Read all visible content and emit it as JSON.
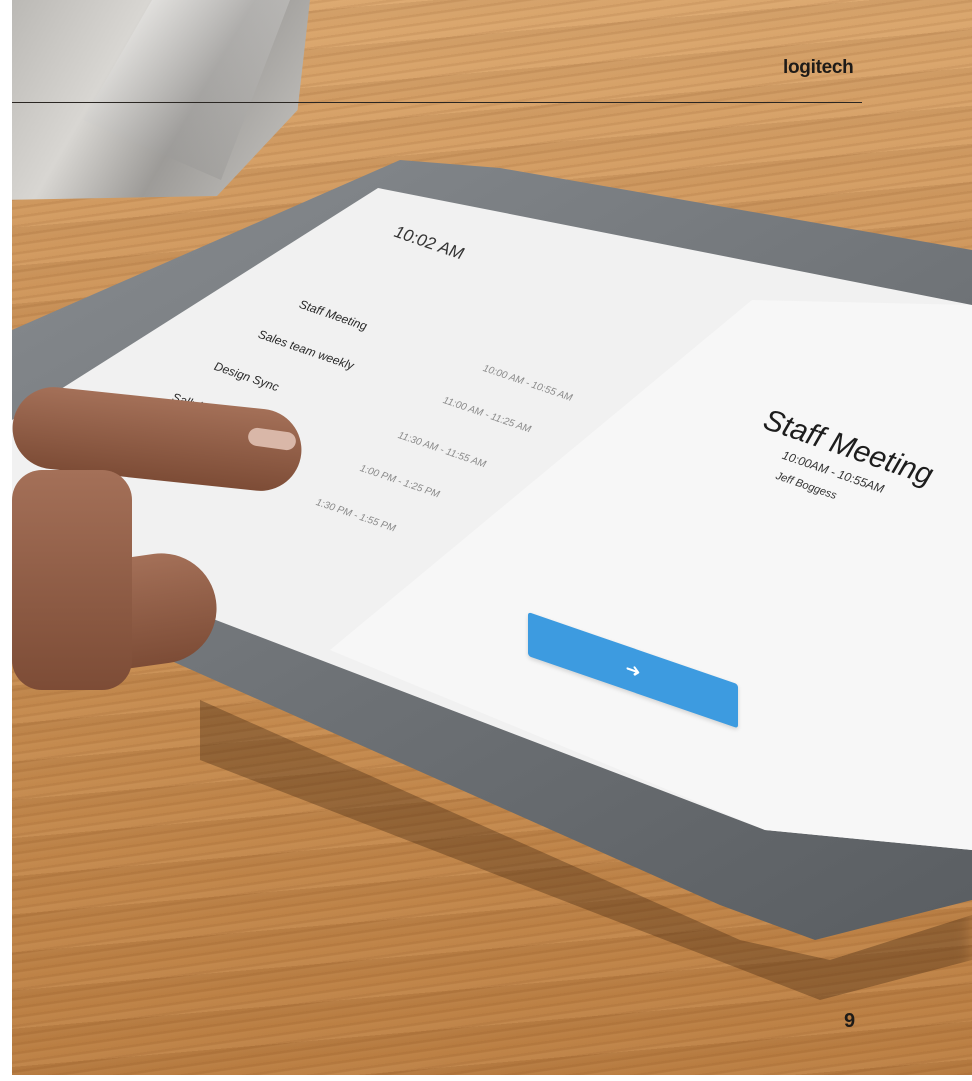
{
  "brand": {
    "logo": "logitech"
  },
  "page": {
    "number": "9"
  },
  "tablet": {
    "clock": "10:02 AM",
    "meetings": [
      {
        "name": "Staff Meeting",
        "slot": "10:00 AM - 10:55 AM"
      },
      {
        "name": "Sales team weekly",
        "slot": "11:00 AM - 11:25 AM"
      },
      {
        "name": "Design Sync",
        "slot": "11:30 AM - 11:55 AM"
      },
      {
        "name": "Sally/Mike 1:1",
        "slot": "1:00 PM - 1:25 PM"
      },
      {
        "name": "",
        "slot": "1:30 PM - 1:55 PM"
      }
    ],
    "selected": {
      "title": "Staff Meeting",
      "time": "10:00AM - 10:55AM",
      "host": "Jeff Boggess"
    },
    "go_button_icon": "arrow-right-icon"
  },
  "colors": {
    "accent": "#3d9be0",
    "rule": "#2a2622"
  }
}
